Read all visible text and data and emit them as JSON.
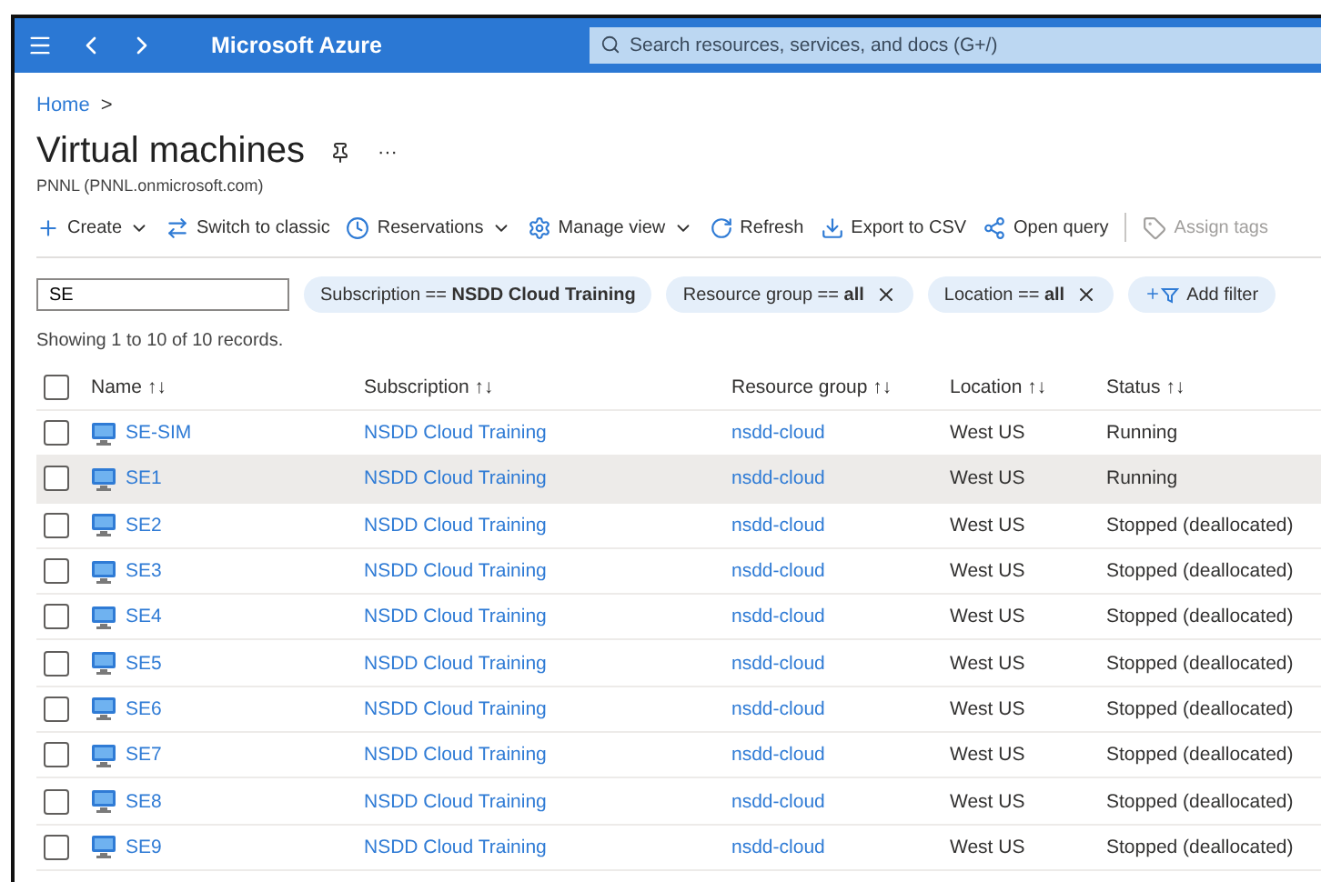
{
  "topbar": {
    "brand": "Microsoft Azure",
    "search": {
      "placeholder": "Search resources, services, and docs (G+/)"
    }
  },
  "breadcrumb": [
    "Home",
    ">"
  ],
  "page": {
    "title": "Virtual machines",
    "more": "···",
    "subtitle": "PNNL (PNNL.onmicrosoft.com)"
  },
  "toolbar": [
    {
      "kind": "create",
      "label": "Create",
      "dropdown": true,
      "disabled": false
    },
    {
      "kind": "switch",
      "label": "Switch to classic",
      "dropdown": false,
      "disabled": false
    },
    {
      "kind": "clock",
      "label": "Reservations",
      "dropdown": true,
      "disabled": false
    },
    {
      "kind": "gear",
      "label": "Manage view",
      "dropdown": true,
      "disabled": false
    },
    {
      "kind": "refresh",
      "label": "Refresh",
      "dropdown": false,
      "disabled": false
    },
    {
      "kind": "download",
      "label": "Export to CSV",
      "dropdown": false,
      "disabled": false
    },
    {
      "kind": "query",
      "label": "Open query",
      "dropdown": false,
      "disabled": false
    },
    {
      "kind": "tag",
      "label": "Assign tags",
      "dropdown": false,
      "disabled": true
    }
  ],
  "filter_box": {
    "value": "SE"
  },
  "filters": [
    {
      "kind": "pill",
      "text": "Subscription == **NSDD Cloud Training**",
      "removable": false
    },
    {
      "kind": "pill",
      "text": "Resource group == **all**",
      "removable": true
    },
    {
      "kind": "pill",
      "text": "Location == **all**",
      "removable": true
    },
    {
      "kind": "add",
      "text": "Add filter"
    }
  ],
  "record_count": "Showing 1 to 10 of 10 records.",
  "table": {
    "select_all": {
      "checked": false
    },
    "columns": [
      {
        "label": "Name",
        "sort": "↑↓"
      },
      {
        "label": "Subscription",
        "sort": "↑↓"
      },
      {
        "label": "Resource group",
        "sort": "↑↓"
      },
      {
        "label": "Location",
        "sort": "↑↓"
      },
      {
        "label": "Status",
        "sort": "↑↓"
      }
    ],
    "rows": [
      {
        "name": "SE-SIM",
        "subscription": "NSDD Cloud Training",
        "resource_group": "nsdd-cloud",
        "location": "West US",
        "status": "Running",
        "selected": false,
        "checked": false
      },
      {
        "name": "SE1",
        "subscription": "NSDD Cloud Training",
        "resource_group": "nsdd-cloud",
        "location": "West US",
        "status": "Running",
        "selected": true,
        "checked": false
      },
      {
        "name": "SE2",
        "subscription": "NSDD Cloud Training",
        "resource_group": "nsdd-cloud",
        "location": "West US",
        "status": "Stopped (deallocated)",
        "selected": false,
        "checked": false
      },
      {
        "name": "SE3",
        "subscription": "NSDD Cloud Training",
        "resource_group": "nsdd-cloud",
        "location": "West US",
        "status": "Stopped (deallocated)",
        "selected": false,
        "checked": false
      },
      {
        "name": "SE4",
        "subscription": "NSDD Cloud Training",
        "resource_group": "nsdd-cloud",
        "location": "West US",
        "status": "Stopped (deallocated)",
        "selected": false,
        "checked": false
      },
      {
        "name": "SE5",
        "subscription": "NSDD Cloud Training",
        "resource_group": "nsdd-cloud",
        "location": "West US",
        "status": "Stopped (deallocated)",
        "selected": false,
        "checked": false
      },
      {
        "name": "SE6",
        "subscription": "NSDD Cloud Training",
        "resource_group": "nsdd-cloud",
        "location": "West US",
        "status": "Stopped (deallocated)",
        "selected": false,
        "checked": false
      },
      {
        "name": "SE7",
        "subscription": "NSDD Cloud Training",
        "resource_group": "nsdd-cloud",
        "location": "West US",
        "status": "Stopped (deallocated)",
        "selected": false,
        "checked": false
      },
      {
        "name": "SE8",
        "subscription": "NSDD Cloud Training",
        "resource_group": "nsdd-cloud",
        "location": "West US",
        "status": "Stopped (deallocated)",
        "selected": false,
        "checked": false
      },
      {
        "name": "SE9",
        "subscription": "NSDD Cloud Training",
        "resource_group": "nsdd-cloud",
        "location": "West US",
        "status": "Stopped (deallocated)",
        "selected": false,
        "checked": false
      }
    ]
  }
}
